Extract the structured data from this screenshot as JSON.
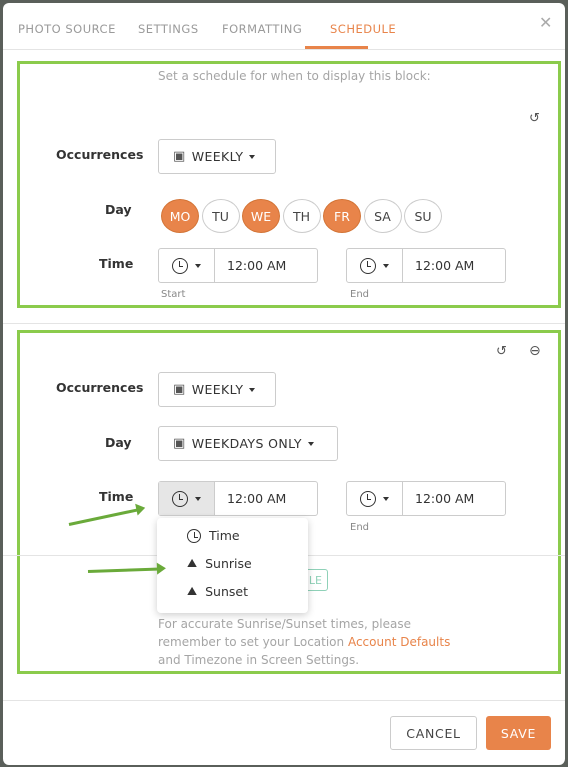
{
  "tabs": [
    "PHOTO SOURCE",
    "SETTINGS",
    "FORMATTING",
    "SCHEDULE"
  ],
  "active_tab": "SCHEDULE",
  "intro": "Set a schedule for when to display this block:",
  "labels": {
    "occurrences": "Occurrences",
    "day": "Day",
    "time": "Time",
    "start": "Start",
    "end": "End"
  },
  "schedule1": {
    "occurrence": "WEEKLY",
    "days": [
      {
        "label": "MO",
        "on": true
      },
      {
        "label": "TU",
        "on": false
      },
      {
        "label": "WE",
        "on": true
      },
      {
        "label": "TH",
        "on": false
      },
      {
        "label": "FR",
        "on": true
      },
      {
        "label": "SA",
        "on": false
      },
      {
        "label": "SU",
        "on": false
      }
    ],
    "start": "12:00 AM",
    "end": "12:00 AM"
  },
  "schedule2": {
    "occurrence": "WEEKLY",
    "day": "WEEKDAYS ONLY",
    "start": "12:00 AM",
    "end": "12:00 AM"
  },
  "time_menu": [
    "Time",
    "Sunrise",
    "Sunset"
  ],
  "hidden_button_fragment": "LE",
  "note": {
    "pre": "For accurate Sunrise/Sunset times, please remember to set your Location ",
    "link": "Account Defaults",
    "post": " and Timezone in Screen Settings."
  },
  "footer": {
    "cancel": "CANCEL",
    "save": "SAVE"
  },
  "colors": {
    "accent": "#e8844a",
    "highlight": "#8bcb4c"
  }
}
